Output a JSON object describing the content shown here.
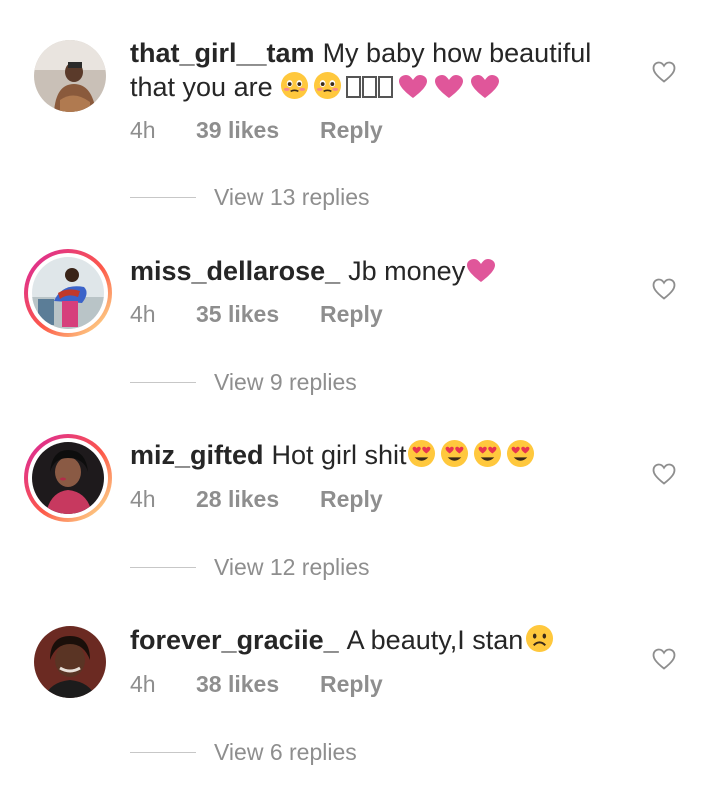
{
  "comments": [
    {
      "username": "that_girl__tam",
      "text": "My baby how beautiful that you are",
      "time": "4h",
      "likes": "39 likes",
      "reply": "Reply",
      "view_replies": "View 13 replies",
      "emojis": [
        "pleading-face",
        "pleading-face",
        "unrenderable",
        "unrenderable",
        "unrenderable",
        "pink-heart",
        "pink-heart",
        "pink-heart"
      ]
    },
    {
      "username": "miss_dellarose_",
      "text": "Jb money",
      "time": "4h",
      "likes": "35 likes",
      "reply": "Reply",
      "view_replies": "View 9 replies",
      "emojis": [
        "pink-heart"
      ]
    },
    {
      "username": "miz_gifted",
      "text": "Hot girl shit",
      "time": "4h",
      "likes": "28 likes",
      "reply": "Reply",
      "view_replies": "View 12 replies",
      "emojis": [
        "heart-eyes",
        "heart-eyes",
        "heart-eyes",
        "heart-eyes"
      ]
    },
    {
      "username": "forever_graciie_",
      "text": "A beauty,I stan",
      "time": "4h",
      "likes": "38 likes",
      "reply": "Reply",
      "view_replies": "View 6 replies",
      "emojis": [
        "frowning-face"
      ]
    }
  ],
  "colors": {
    "pink_heart": "#e0569a",
    "muted_text": "#8e8e8e",
    "story_ring_start": "#d6249f",
    "story_ring_end": "#fdf497"
  }
}
